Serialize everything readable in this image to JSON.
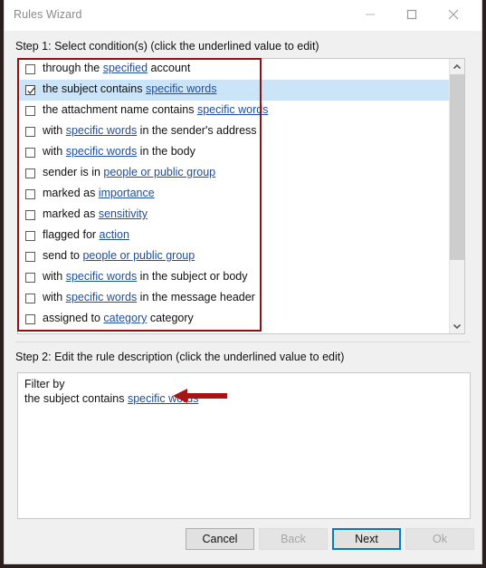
{
  "window": {
    "title": "Rules Wizard",
    "controls": [
      {
        "name": "minimize-button",
        "glyph": "minimize-icon"
      },
      {
        "name": "maximize-button",
        "glyph": "maximize-icon"
      },
      {
        "name": "close-button",
        "glyph": "close-icon"
      }
    ]
  },
  "step1": {
    "label": "Step 1: Select condition(s) (click the underlined value to edit)",
    "conditions": [
      {
        "checked": false,
        "selected": false,
        "pre": "through the ",
        "link": "specified",
        "post": " account"
      },
      {
        "checked": true,
        "selected": true,
        "pre": "the subject contains ",
        "link": "specific words",
        "post": ""
      },
      {
        "checked": false,
        "selected": false,
        "pre": "the attachment name contains ",
        "link": "specific words",
        "post": ""
      },
      {
        "checked": false,
        "selected": false,
        "pre": "with ",
        "link": "specific words",
        "post": " in the sender's address"
      },
      {
        "checked": false,
        "selected": false,
        "pre": "with ",
        "link": "specific words",
        "post": " in the body"
      },
      {
        "checked": false,
        "selected": false,
        "pre": "sender is in ",
        "link": "people or public group",
        "post": ""
      },
      {
        "checked": false,
        "selected": false,
        "pre": "marked as ",
        "link": "importance",
        "post": ""
      },
      {
        "checked": false,
        "selected": false,
        "pre": "marked as ",
        "link": "sensitivity",
        "post": ""
      },
      {
        "checked": false,
        "selected": false,
        "pre": "flagged for ",
        "link": "action",
        "post": ""
      },
      {
        "checked": false,
        "selected": false,
        "pre": "send to ",
        "link": "people or public group",
        "post": ""
      },
      {
        "checked": false,
        "selected": false,
        "pre": "with ",
        "link": "specific words",
        "post": " in the subject or body"
      },
      {
        "checked": false,
        "selected": false,
        "pre": "with ",
        "link": "specific words",
        "post": " in the message header"
      },
      {
        "checked": false,
        "selected": false,
        "pre": "assigned to ",
        "link": "category",
        "post": " category"
      }
    ],
    "scrollbar": {
      "up_arrow": "chevron-up-icon",
      "down_arrow": "chevron-down-icon",
      "thumb_position_percent": 0
    },
    "highlight_color": "#cce4f7",
    "annotation_box_color": "#8f1111"
  },
  "step2": {
    "label": "Step 2: Edit the rule description (click the underlined value to edit)",
    "description_line_1": "Filter by",
    "description_line_2_pre": "the subject contains ",
    "description_line_2_link": "specific words",
    "annotation_arrow_color": "#a81414"
  },
  "buttons": {
    "cancel": "Cancel",
    "back": "Back",
    "next": "Next",
    "ok": "Ok"
  },
  "colors": {
    "link": "#1d4fa0",
    "focus": "#0078d7",
    "annotation_red": "#8f1111"
  }
}
